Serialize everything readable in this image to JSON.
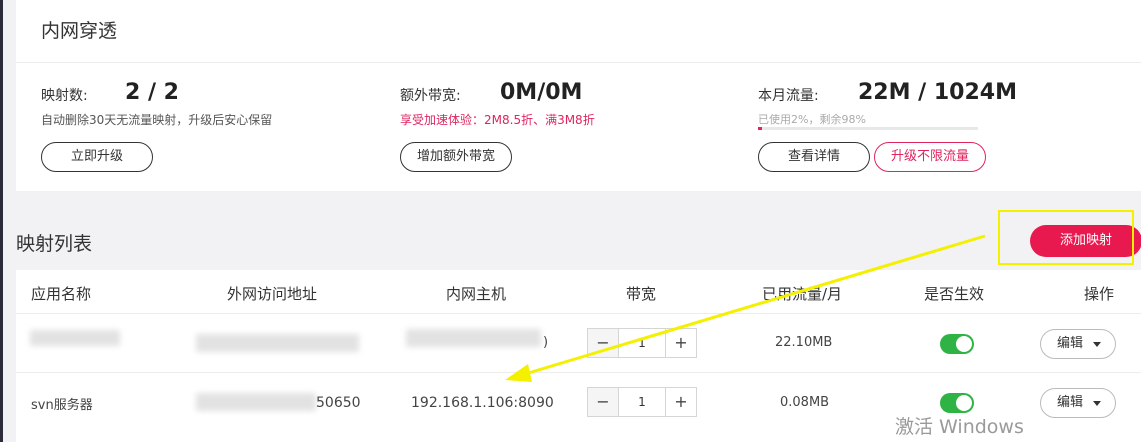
{
  "card": {
    "title": "内网穿透",
    "mappings": {
      "label": "映射数:",
      "value": "2 / 2",
      "note": "自动删除30天无流量映射，升级后安心保留",
      "button": "立即升级"
    },
    "bandwidth": {
      "label": "额外带宽:",
      "value": "0M/0M",
      "note": "享受加速体验：2M8.5折、满3M8折",
      "button": "增加额外带宽"
    },
    "traffic": {
      "label": "本月流量:",
      "value": "22M / 1024M",
      "note": "已使用2%，剩余98%",
      "used_percent": 2,
      "button_detail": "查看详情",
      "button_upgrade": "升级不限流量"
    }
  },
  "section": {
    "title": "映射列表",
    "add_button": "添加映射"
  },
  "table": {
    "headers": [
      "应用名称",
      "外网访问地址",
      "内网主机",
      "带宽",
      "已用流量/月",
      "是否生效",
      "操作"
    ],
    "rows": [
      {
        "name": "",
        "address": "",
        "host": ")",
        "bandwidth": "1",
        "traffic": "22.10MB",
        "enabled": true,
        "action": "编辑"
      },
      {
        "name": "svn服务器",
        "address": "50650",
        "host": "192.168.1.106:8090",
        "bandwidth": "1",
        "traffic": "0.08MB",
        "enabled": true,
        "action": "编辑"
      }
    ]
  },
  "stepper": {
    "minus": "−",
    "plus": "+"
  },
  "watermark": "激活 Windows",
  "colors": {
    "accent": "#e8194f",
    "toggle_on": "#2fb344",
    "annotation": "#f3f000"
  },
  "annotation": {
    "box_color": "#f3f000",
    "arrow_color": "#f3f000"
  }
}
